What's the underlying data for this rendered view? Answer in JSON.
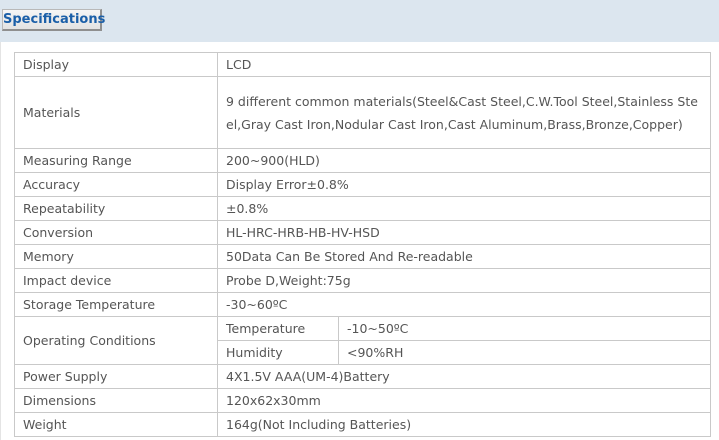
{
  "tab": {
    "label": "Specifications"
  },
  "specs": {
    "display": {
      "label": "Display",
      "value": "LCD"
    },
    "materials": {
      "label": "Materials",
      "value": "9 different common materials(Steel&Cast Steel,C.W.Tool Steel,Stainless Steel,Gray Cast Iron,Nodular Cast Iron,Cast Aluminum,Brass,Bronze,Copper)"
    },
    "measuring_range": {
      "label": "Measuring Range",
      "value": "200~900(HLD)"
    },
    "accuracy": {
      "label": "Accuracy",
      "value": "Display Error±0.8%"
    },
    "repeatability": {
      "label": "Repeatability",
      "value": "±0.8%"
    },
    "conversion": {
      "label": "Conversion",
      "value": "HL-HRC-HRB-HB-HV-HSD"
    },
    "memory": {
      "label": "Memory",
      "value": "50Data Can Be Stored And Re-readable"
    },
    "impact_device": {
      "label": "Impact device",
      "value": "Probe D,Weight:75g"
    },
    "storage_temperature": {
      "label": "Storage Temperature",
      "value": "-30~60ºC"
    },
    "operating_conditions": {
      "label": "Operating Conditions",
      "temperature": {
        "label": "Temperature",
        "value": "-10~50ºC"
      },
      "humidity": {
        "label": "Humidity",
        "value": "<90%RH"
      }
    },
    "power_supply": {
      "label": "Power Supply",
      "value": "4X1.5V AAA(UM-4)Battery"
    },
    "dimensions": {
      "label": "Dimensions",
      "value": "120x62x30mm"
    },
    "weight": {
      "label": "Weight",
      "value": "164g(Not Including Batteries)"
    }
  }
}
